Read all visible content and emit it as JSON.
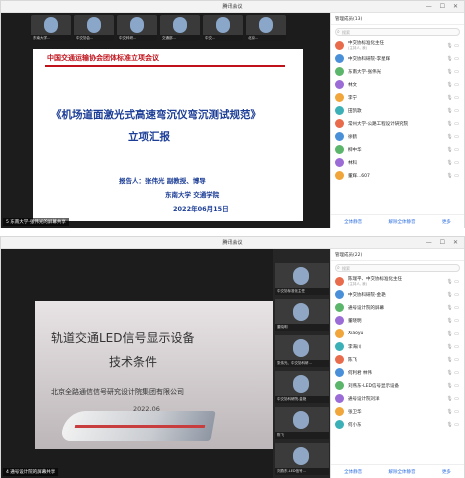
{
  "window_title": "腾讯会议",
  "top": {
    "thumbnails": [
      {
        "label": "东南大学..."
      },
      {
        "label": "中交协会..."
      },
      {
        "label": "中交科研..."
      },
      {
        "label": "交通部..."
      },
      {
        "label": "中交..."
      },
      {
        "label": "北京..."
      }
    ],
    "slide": {
      "header": "中国交通运输协会团体标准立项会议",
      "title": "《机场道面激光式高速弯沉仪弯沉测试规范》",
      "subtitle": "立项汇报",
      "reporter": "报告人：张伟光 副教授、博导",
      "org": "东南大学 交通学院",
      "date": "2022年06月15日"
    },
    "share_label": "5 东南大学-张伟光的屏幕共享",
    "panel": {
      "header": "管理成员(13)",
      "search_placeholder": "搜索",
      "members": [
        {
          "name": "中交协标准化主任",
          "sub": "(主持人, 我)"
        },
        {
          "name": "中交协科研院-李星辉",
          "sub": ""
        },
        {
          "name": "东南大学-张伟光",
          "sub": ""
        },
        {
          "name": "林文",
          "sub": ""
        },
        {
          "name": "李宁",
          "sub": ""
        },
        {
          "name": "田凯歌",
          "sub": ""
        },
        {
          "name": "常州大学-公路工程设计研究院",
          "sub": ""
        },
        {
          "name": "徐鹤",
          "sub": ""
        },
        {
          "name": "柳中华",
          "sub": ""
        },
        {
          "name": "林科",
          "sub": ""
        },
        {
          "name": "董辉...607",
          "sub": ""
        }
      ],
      "btn_mute_all": "全体静音",
      "btn_unmute_all": "解除全体静音",
      "btn_more": "更多"
    }
  },
  "bottom": {
    "slide": {
      "title1": "轨道交通LED信号显示设备",
      "title2": "技术条件",
      "org": "北京全路通信信号研究设计院集团有限公司",
      "date": "2022.06"
    },
    "share_label": "4 通号设计院的屏幕共享",
    "video_tiles": [
      {
        "label": "中交协标准化主任"
      },
      {
        "label": "董晓明"
      },
      {
        "label": "张伟光、中交协科研..."
      },
      {
        "label": "中交协科研院-金艳"
      },
      {
        "label": "陈飞"
      },
      {
        "label": "刘燕东-LED信号..."
      }
    ],
    "panel": {
      "header": "管理成员(22)",
      "search_placeholder": "搜索",
      "members": [
        {
          "name": "陈瑞平、中交协标准化主任",
          "sub": "(主持人, 我)"
        },
        {
          "name": "中交协科研院-金艳",
          "sub": ""
        },
        {
          "name": "通号设计院的屏幕",
          "sub": ""
        },
        {
          "name": "董晓明",
          "sub": ""
        },
        {
          "name": "Xiaoyu",
          "sub": ""
        },
        {
          "name": "李海川",
          "sub": ""
        },
        {
          "name": "陈飞",
          "sub": ""
        },
        {
          "name": "何利君 林伟",
          "sub": ""
        },
        {
          "name": "刘燕东-LED信号显示设备",
          "sub": ""
        },
        {
          "name": "通号设计院刘洋",
          "sub": ""
        },
        {
          "name": "张卫华",
          "sub": ""
        },
        {
          "name": "何小东",
          "sub": ""
        }
      ],
      "btn_mute_all": "全体静音",
      "btn_unmute_all": "解除全体静音",
      "btn_more": "更多"
    }
  },
  "colors": {
    "accent": "#2b6de0",
    "slide_title_blue": "#1b3d96",
    "slide_header_red": "#c0121b"
  }
}
